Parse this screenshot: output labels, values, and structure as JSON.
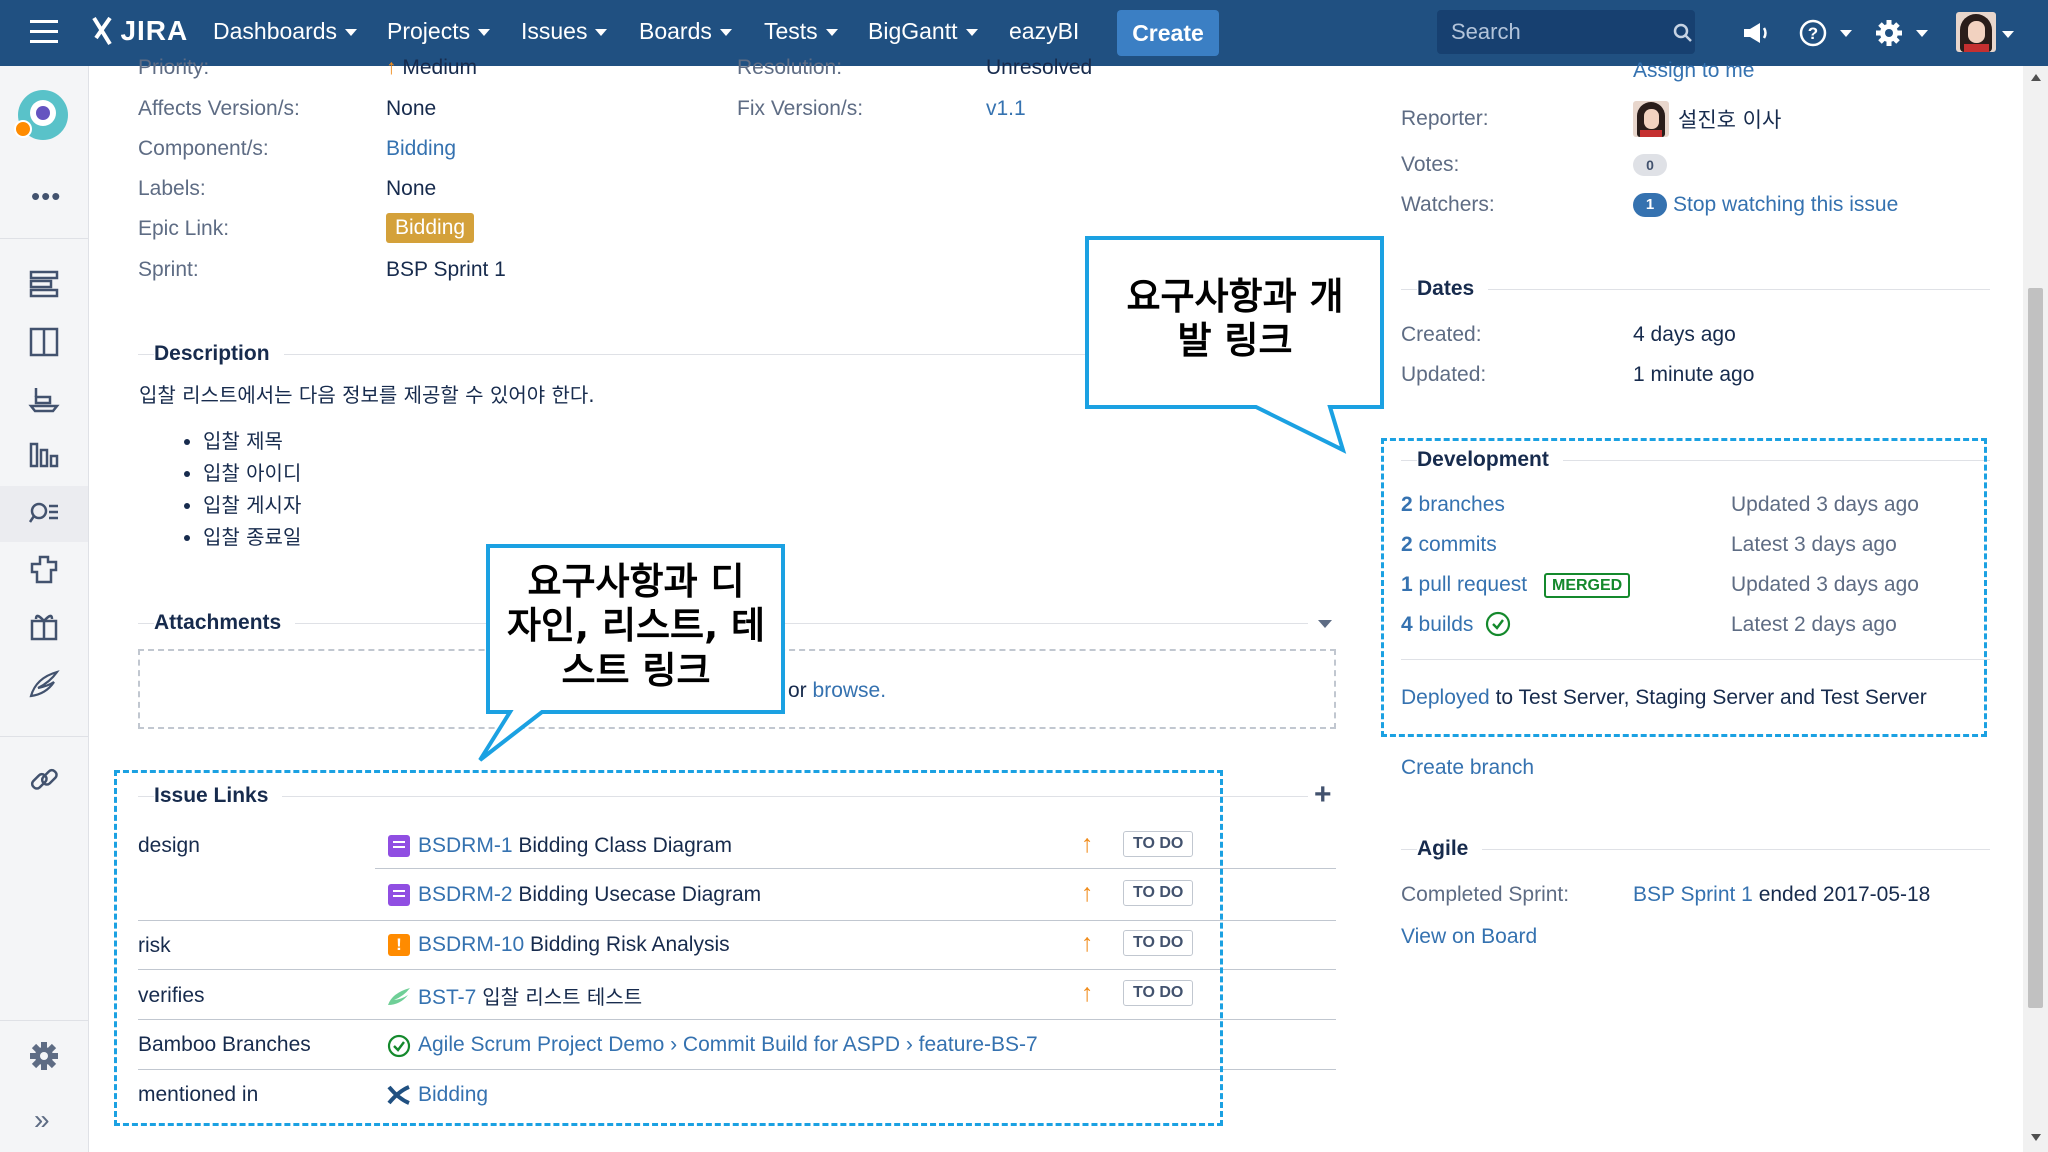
{
  "nav": {
    "logo_text": "JIRA",
    "items": [
      "Dashboards",
      "Projects",
      "Issues",
      "Boards",
      "Tests",
      "BigGantt",
      "eazyBI"
    ],
    "create_label": "Create",
    "search_placeholder": "Search"
  },
  "details": {
    "priority_label": "Priority:",
    "priority_value": "Medium",
    "resolution_label": "Resolution:",
    "resolution_value": "Unresolved",
    "affects_label": "Affects Version/s:",
    "affects_value": "None",
    "fix_label": "Fix Version/s:",
    "fix_value": "v1.1",
    "component_label": "Component/s:",
    "component_value": "Bidding",
    "labels_label": "Labels:",
    "labels_value": "None",
    "epic_label": "Epic Link:",
    "epic_value": "Bidding",
    "sprint_label": "Sprint:",
    "sprint_value": "BSP Sprint 1"
  },
  "description": {
    "title": "Description",
    "text": "입찰 리스트에서는 다음 정보를 제공할 수 있어야 한다.",
    "items": [
      "입찰 제목",
      "입찰 아이디",
      "입찰 게시자",
      "입찰 종료일"
    ]
  },
  "attachments": {
    "title": "Attachments",
    "drop_text_suffix": "or",
    "browse_label": "browse."
  },
  "issue_links": {
    "title": "Issue Links",
    "rows": [
      {
        "type": "design",
        "key": "BSDRM-1",
        "summary": "Bidding Class Diagram",
        "status": "TO DO"
      },
      {
        "type": "",
        "key": "BSDRM-2",
        "summary": "Bidding Usecase Diagram",
        "status": "TO DO"
      },
      {
        "type": "risk",
        "key": "BSDRM-10",
        "summary": "Bidding Risk Analysis",
        "status": "TO DO"
      },
      {
        "type": "verifies",
        "key": "BST-7",
        "summary": "입찰 리스트 테스트",
        "status": "TO DO"
      }
    ],
    "bamboo_label": "Bamboo Branches",
    "bamboo_path": [
      "Agile Scrum Project Demo",
      "Commit Build for ASPD",
      "feature-BS-7"
    ],
    "mentioned_label": "mentioned in",
    "mentioned_value": "Bidding"
  },
  "people": {
    "assign_label": "Assign to me",
    "reporter_label": "Reporter:",
    "reporter_value": "설진호 이사",
    "votes_label": "Votes:",
    "votes_count": "0",
    "watchers_label": "Watchers:",
    "watchers_count": "1",
    "watch_action": "Stop watching this issue"
  },
  "dates": {
    "title": "Dates",
    "created_label": "Created:",
    "created_value": "4 days ago",
    "updated_label": "Updated:",
    "updated_value": "1 minute ago"
  },
  "development": {
    "title": "Development",
    "branches_count": "2",
    "branches_label": "branches",
    "branches_info": "Updated 3 days ago",
    "commits_count": "2",
    "commits_label": "commits",
    "commits_info": "Latest 3 days ago",
    "pr_count": "1",
    "pr_label": "pull request",
    "pr_status": "MERGED",
    "pr_info": "Updated 3 days ago",
    "builds_count": "4",
    "builds_label": "builds",
    "builds_info": "Latest 2 days ago",
    "deployed_link": "Deployed",
    "deployed_text": "to Test Server, Staging Server and Test Server",
    "create_branch": "Create branch"
  },
  "agile": {
    "title": "Agile",
    "completed_label": "Completed Sprint:",
    "sprint_link": "BSP Sprint 1",
    "sprint_suffix": "ended 2017-05-18",
    "view_board": "View on Board"
  },
  "callouts": {
    "dev_link_line1": "요구사항과 개",
    "dev_link_line2": "발 링크",
    "issue_link_line1": "요구사항과 디",
    "issue_link_line2": "자인, 리스트, 테",
    "issue_link_line3": "스트 링크"
  },
  "colors": {
    "nav_bg": "#205081",
    "link": "#3572b0",
    "callout_border": "#1ba1e2",
    "epic_bg": "#d4a13a",
    "merged_green": "#14892c",
    "priority_orange": "#f08c1c"
  }
}
